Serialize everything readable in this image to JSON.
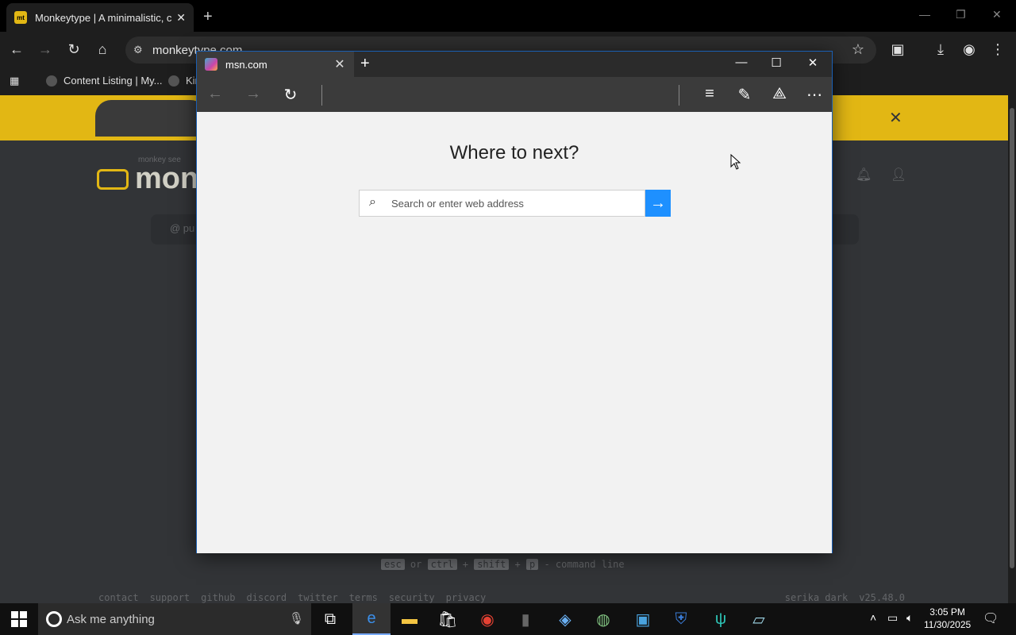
{
  "chrome": {
    "tab_title": "Monkeytype | A minimalistic, cu",
    "tab_favicon": "mt",
    "url": "monkeytype.com",
    "bookmarks": [
      {
        "label": "Content Listing | My..."
      },
      {
        "label": "Kin"
      }
    ],
    "colors": {
      "frame": "#000000",
      "toolbar": "#1e1e1e"
    }
  },
  "monkeytype": {
    "logo_small": "monkey see",
    "logo_word": "monk",
    "config_left": "@ pu",
    "hint": {
      "k1": "esc",
      "or": "or",
      "k2": "ctrl",
      "k3": "shift",
      "k4": "p",
      "text": "- command line"
    },
    "footer": {
      "links": [
        "contact",
        "support",
        "github",
        "discord",
        "twitter",
        "terms",
        "security",
        "privacy"
      ],
      "theme": "serika dark",
      "version": "v25.48.0"
    },
    "colors": {
      "bg": "#323437",
      "accent": "#e2b714",
      "text": "#646669"
    }
  },
  "edge": {
    "tab_title": "msn.com",
    "heading": "Where to next?",
    "search_placeholder": "Search or enter web address",
    "colors": {
      "go_button": "#1e90ff",
      "frame": "#3b3b3b",
      "page": "#f2f2f2"
    }
  },
  "taskbar": {
    "search_placeholder": "Ask me anything",
    "time": "3:05 PM",
    "date": "11/30/2025",
    "apps": [
      "task-view-icon",
      "edge-icon",
      "file-explorer-icon",
      "store-icon",
      "chrome-icon",
      "app-icon",
      "network-app-icon",
      "globe-app-icon",
      "virtualbox-icon",
      "shield-app-icon",
      "fork-knife-app-icon",
      "notepad-icon"
    ]
  }
}
